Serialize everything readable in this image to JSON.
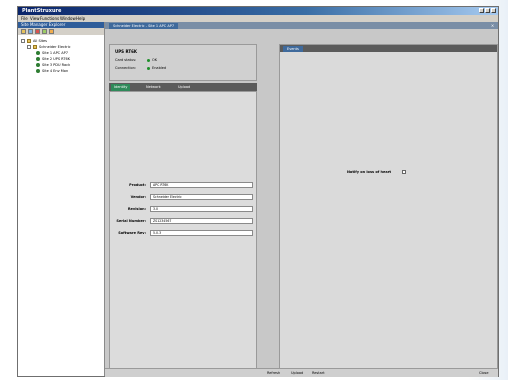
{
  "window": {
    "title": "PlantStruxure"
  },
  "menu": [
    "File",
    "View",
    "Functions",
    "Window",
    "Help"
  ],
  "tree": {
    "header": "Site Manager Explorer",
    "nodes": [
      {
        "label": "All Sites"
      },
      {
        "label": "Schneider Electric"
      },
      {
        "label": "Site 1 APC AP7"
      },
      {
        "label": "Site 2 UPS RT6K"
      },
      {
        "label": "Site 3 PDU Rack"
      },
      {
        "label": "Site 4 Env Mon"
      }
    ]
  },
  "document_tab": {
    "label": "Schneider Electric - Site 1 APC AP7"
  },
  "device": {
    "name": "UPS RT6K",
    "status_label": "Card status:",
    "status_value": "OK",
    "connection_label": "Connection:",
    "connection_value": "Enabled"
  },
  "left_tabs": [
    "Identity",
    "Network",
    "Upload"
  ],
  "fields": [
    {
      "label": "Product:",
      "value": "APC RT6K"
    },
    {
      "label": "Vendor:",
      "value": "Schneider Electric"
    },
    {
      "label": "Revision:",
      "value": "3.0"
    },
    {
      "label": "Serial Number:",
      "value": "ZS1234567"
    },
    {
      "label": "Software Rev:",
      "value": "5.0.3"
    }
  ],
  "right_tab": {
    "label": "Events"
  },
  "notify": {
    "label": "Notify on loss of heart",
    "checked": false
  },
  "bottom": {
    "buttons": [
      "Refresh",
      "Upload",
      "Restart"
    ],
    "close": "Close"
  },
  "colors": {
    "titlebar": "#0a246a",
    "tab_active": "#3f6a9c",
    "status_ok": "#1f8f2a"
  }
}
